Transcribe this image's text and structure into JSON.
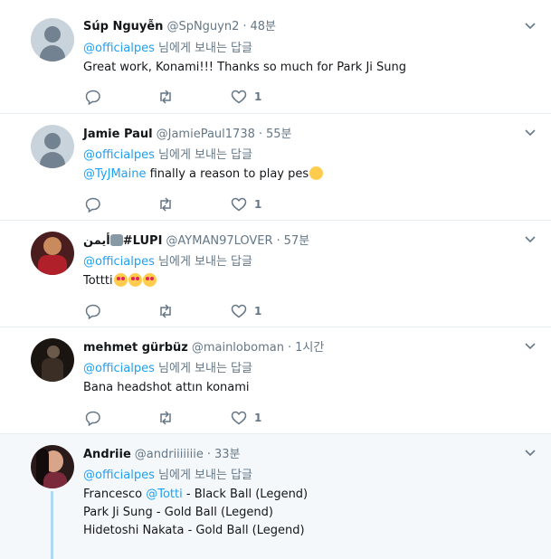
{
  "tweets": [
    {
      "name": "Súp Nguyễn",
      "handle": "@SpNguyn2",
      "sep": "·",
      "time": "48분",
      "reply_mention": "@officialpes",
      "reply_suffix": " 님에게 보내는 답글",
      "text": "Great work, Konami!!! Thanks so much for Park Ji Sung",
      "like_count": "1",
      "avatar": "default-avatar"
    },
    {
      "name": "Jamie Paul",
      "handle": "@JamiePaul1738",
      "sep": "·",
      "time": "55분",
      "reply_mention": "@officialpes",
      "reply_suffix": " 님에게 보내는 답글",
      "text_mention": "@TyJMaine",
      "text": " finally a reason to play pes",
      "like_count": "1",
      "avatar": "default-avatar",
      "emoji": "thinking-face"
    },
    {
      "name_left": "أيمن",
      "name_right": "#LUPI",
      "handle": "@AYMAN97LOVER",
      "sep": "·",
      "time": "57분",
      "reply_mention": "@officialpes",
      "reply_suffix": " 님에게 보내는 답글",
      "text": "Tottti",
      "like_count": "1",
      "avatar": "photo-avatar",
      "emoji": "heart-eyes"
    },
    {
      "name": "mehmet gürbüz",
      "handle": "@mainloboman",
      "sep": "·",
      "time": "1시간",
      "reply_mention": "@officialpes",
      "reply_suffix": " 님에게 보내는 답글",
      "text": "Bana headshot attın konami",
      "like_count": "1",
      "avatar": "photo-avatar"
    },
    {
      "name": "Andriie",
      "handle": "@andriiiiiiie",
      "sep": "·",
      "time": "33분",
      "reply_mention": "@officialpes",
      "reply_suffix": " 님에게 보내는 답글",
      "line1_pre": "Francesco ",
      "line1_mention": "@Totti",
      "line1_post": " - Black Ball (Legend)",
      "line2": "Park Ji Sung - Gold Ball (Legend)",
      "line3": "Hidetoshi Nakata - Gold Ball (Legend)",
      "avatar": "photo-avatar"
    }
  ],
  "colors": {
    "accent": "#1da1f2",
    "muted": "#657786",
    "text": "#14171a",
    "divider": "#e6ecf0",
    "highlight_bg": "#f5f8fa"
  }
}
